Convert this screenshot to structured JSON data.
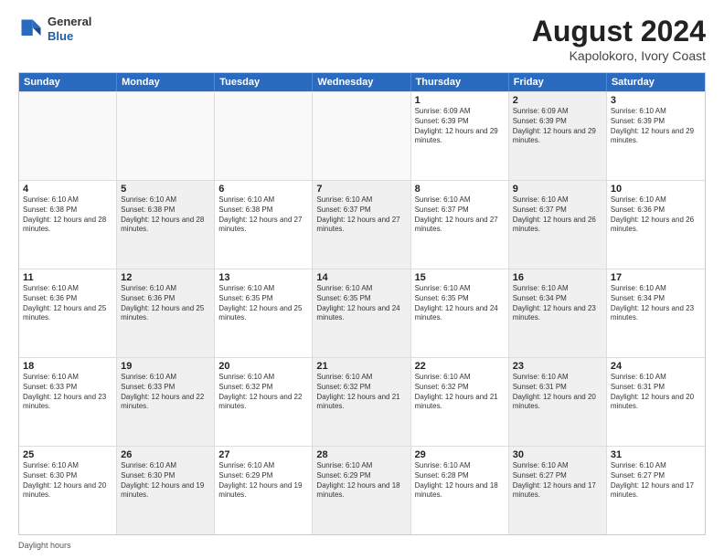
{
  "header": {
    "logo_line1": "General",
    "logo_line2": "Blue",
    "title": "August 2024",
    "subtitle": "Kapolokoro, Ivory Coast"
  },
  "calendar": {
    "days": [
      "Sunday",
      "Monday",
      "Tuesday",
      "Wednesday",
      "Thursday",
      "Friday",
      "Saturday"
    ],
    "rows": [
      [
        {
          "day": "",
          "empty": true
        },
        {
          "day": "",
          "empty": true
        },
        {
          "day": "",
          "empty": true
        },
        {
          "day": "",
          "empty": true
        },
        {
          "day": "1",
          "rise": "6:09 AM",
          "set": "6:39 PM",
          "hours": "12 hours and 29 minutes.",
          "shaded": false
        },
        {
          "day": "2",
          "rise": "6:09 AM",
          "set": "6:39 PM",
          "hours": "12 hours and 29 minutes.",
          "shaded": true
        },
        {
          "day": "3",
          "rise": "6:10 AM",
          "set": "6:39 PM",
          "hours": "12 hours and 29 minutes.",
          "shaded": false
        }
      ],
      [
        {
          "day": "4",
          "rise": "6:10 AM",
          "set": "6:38 PM",
          "hours": "12 hours and 28 minutes.",
          "shaded": false
        },
        {
          "day": "5",
          "rise": "6:10 AM",
          "set": "6:38 PM",
          "hours": "12 hours and 28 minutes.",
          "shaded": true
        },
        {
          "day": "6",
          "rise": "6:10 AM",
          "set": "6:38 PM",
          "hours": "12 hours and 27 minutes.",
          "shaded": false
        },
        {
          "day": "7",
          "rise": "6:10 AM",
          "set": "6:37 PM",
          "hours": "12 hours and 27 minutes.",
          "shaded": true
        },
        {
          "day": "8",
          "rise": "6:10 AM",
          "set": "6:37 PM",
          "hours": "12 hours and 27 minutes.",
          "shaded": false
        },
        {
          "day": "9",
          "rise": "6:10 AM",
          "set": "6:37 PM",
          "hours": "12 hours and 26 minutes.",
          "shaded": true
        },
        {
          "day": "10",
          "rise": "6:10 AM",
          "set": "6:36 PM",
          "hours": "12 hours and 26 minutes.",
          "shaded": false
        }
      ],
      [
        {
          "day": "11",
          "rise": "6:10 AM",
          "set": "6:36 PM",
          "hours": "12 hours and 25 minutes.",
          "shaded": false
        },
        {
          "day": "12",
          "rise": "6:10 AM",
          "set": "6:36 PM",
          "hours": "12 hours and 25 minutes.",
          "shaded": true
        },
        {
          "day": "13",
          "rise": "6:10 AM",
          "set": "6:35 PM",
          "hours": "12 hours and 25 minutes.",
          "shaded": false
        },
        {
          "day": "14",
          "rise": "6:10 AM",
          "set": "6:35 PM",
          "hours": "12 hours and 24 minutes.",
          "shaded": true
        },
        {
          "day": "15",
          "rise": "6:10 AM",
          "set": "6:35 PM",
          "hours": "12 hours and 24 minutes.",
          "shaded": false
        },
        {
          "day": "16",
          "rise": "6:10 AM",
          "set": "6:34 PM",
          "hours": "12 hours and 23 minutes.",
          "shaded": true
        },
        {
          "day": "17",
          "rise": "6:10 AM",
          "set": "6:34 PM",
          "hours": "12 hours and 23 minutes.",
          "shaded": false
        }
      ],
      [
        {
          "day": "18",
          "rise": "6:10 AM",
          "set": "6:33 PM",
          "hours": "12 hours and 23 minutes.",
          "shaded": false
        },
        {
          "day": "19",
          "rise": "6:10 AM",
          "set": "6:33 PM",
          "hours": "12 hours and 22 minutes.",
          "shaded": true
        },
        {
          "day": "20",
          "rise": "6:10 AM",
          "set": "6:32 PM",
          "hours": "12 hours and 22 minutes.",
          "shaded": false
        },
        {
          "day": "21",
          "rise": "6:10 AM",
          "set": "6:32 PM",
          "hours": "12 hours and 21 minutes.",
          "shaded": true
        },
        {
          "day": "22",
          "rise": "6:10 AM",
          "set": "6:32 PM",
          "hours": "12 hours and 21 minutes.",
          "shaded": false
        },
        {
          "day": "23",
          "rise": "6:10 AM",
          "set": "6:31 PM",
          "hours": "12 hours and 20 minutes.",
          "shaded": true
        },
        {
          "day": "24",
          "rise": "6:10 AM",
          "set": "6:31 PM",
          "hours": "12 hours and 20 minutes.",
          "shaded": false
        }
      ],
      [
        {
          "day": "25",
          "rise": "6:10 AM",
          "set": "6:30 PM",
          "hours": "12 hours and 20 minutes.",
          "shaded": false
        },
        {
          "day": "26",
          "rise": "6:10 AM",
          "set": "6:30 PM",
          "hours": "12 hours and 19 minutes.",
          "shaded": true
        },
        {
          "day": "27",
          "rise": "6:10 AM",
          "set": "6:29 PM",
          "hours": "12 hours and 19 minutes.",
          "shaded": false
        },
        {
          "day": "28",
          "rise": "6:10 AM",
          "set": "6:29 PM",
          "hours": "12 hours and 18 minutes.",
          "shaded": true
        },
        {
          "day": "29",
          "rise": "6:10 AM",
          "set": "6:28 PM",
          "hours": "12 hours and 18 minutes.",
          "shaded": false
        },
        {
          "day": "30",
          "rise": "6:10 AM",
          "set": "6:27 PM",
          "hours": "12 hours and 17 minutes.",
          "shaded": true
        },
        {
          "day": "31",
          "rise": "6:10 AM",
          "set": "6:27 PM",
          "hours": "12 hours and 17 minutes.",
          "shaded": false
        }
      ]
    ]
  },
  "footer": {
    "note": "Daylight hours"
  }
}
